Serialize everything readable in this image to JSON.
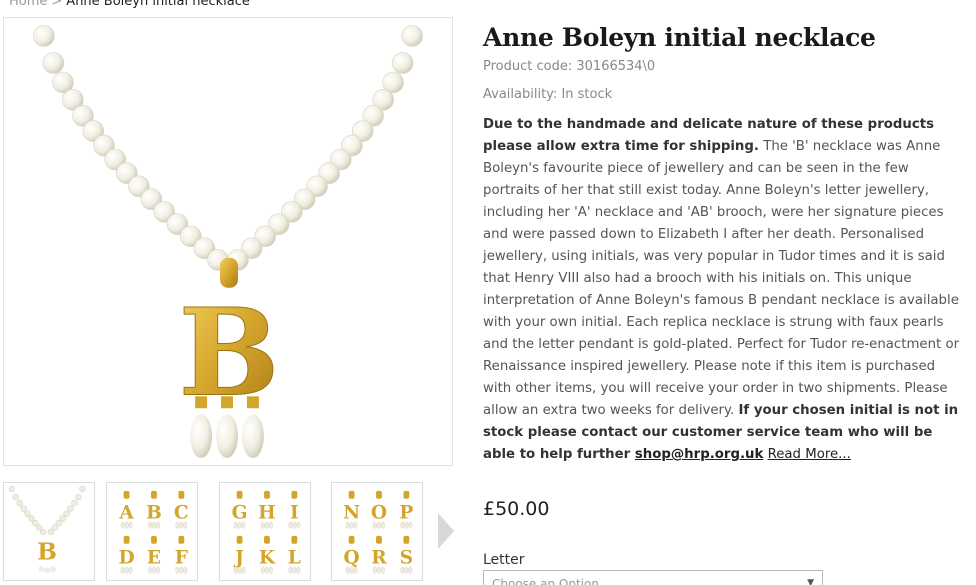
{
  "breadcrumb": {
    "home": "Home",
    "separator": ">",
    "current": "Anne Boleyn initial necklace"
  },
  "product": {
    "title": "Anne Boleyn initial necklace",
    "code_label": "Product code:",
    "code": "30166534\\0",
    "availability_label": "Availability:",
    "availability": "In stock",
    "price": "£50.00"
  },
  "description": {
    "bold_intro": "Due to the handmade and delicate nature of these products please allow extra time for shipping.",
    "body": " The 'B' necklace was Anne Boleyn's favourite piece of jewellery and can be seen in the few portraits of her that still exist today. Anne Boleyn's letter jewellery, including her 'A' necklace and 'AB' brooch, were her signature pieces and were passed down to Elizabeth I after her death. Personalised jewellery, using initials, was very popular in Tudor times and it is said that Henry VIII also had a brooch with his initials on. This unique interpretation of Anne Boleyn's famous B pendant necklace is available with your own initial. Each replica necklace is strung with faux pearls and the letter pendant is gold-plated. Perfect for Tudor re-enactment or Renaissance inspired jewellery. Please note if this item is purchased with other items, you will receive your order in two shipments. Please allow an extra two weeks for delivery. ",
    "bold_outro": "If your chosen initial is not in stock please contact our customer service team who will be able to help further ",
    "email": "shop@hrp.org.uk",
    "read_more": "Read More..."
  },
  "options": {
    "letter_label": "Letter",
    "select_placeholder": "Choose an Option..."
  },
  "images": {
    "main_letter": "B",
    "thumbnails": [
      {
        "letters": [
          "B"
        ]
      },
      {
        "letters": [
          "A",
          "B",
          "C",
          "D",
          "E",
          "F"
        ]
      },
      {
        "letters": [
          "G",
          "H",
          "I",
          "J",
          "K",
          "L"
        ]
      },
      {
        "letters": [
          "N",
          "O",
          "P",
          "Q",
          "R",
          "S"
        ]
      }
    ]
  },
  "colors": {
    "gold": "#d4a52c",
    "pearl": "#f3f1e6",
    "text": "#555555"
  }
}
